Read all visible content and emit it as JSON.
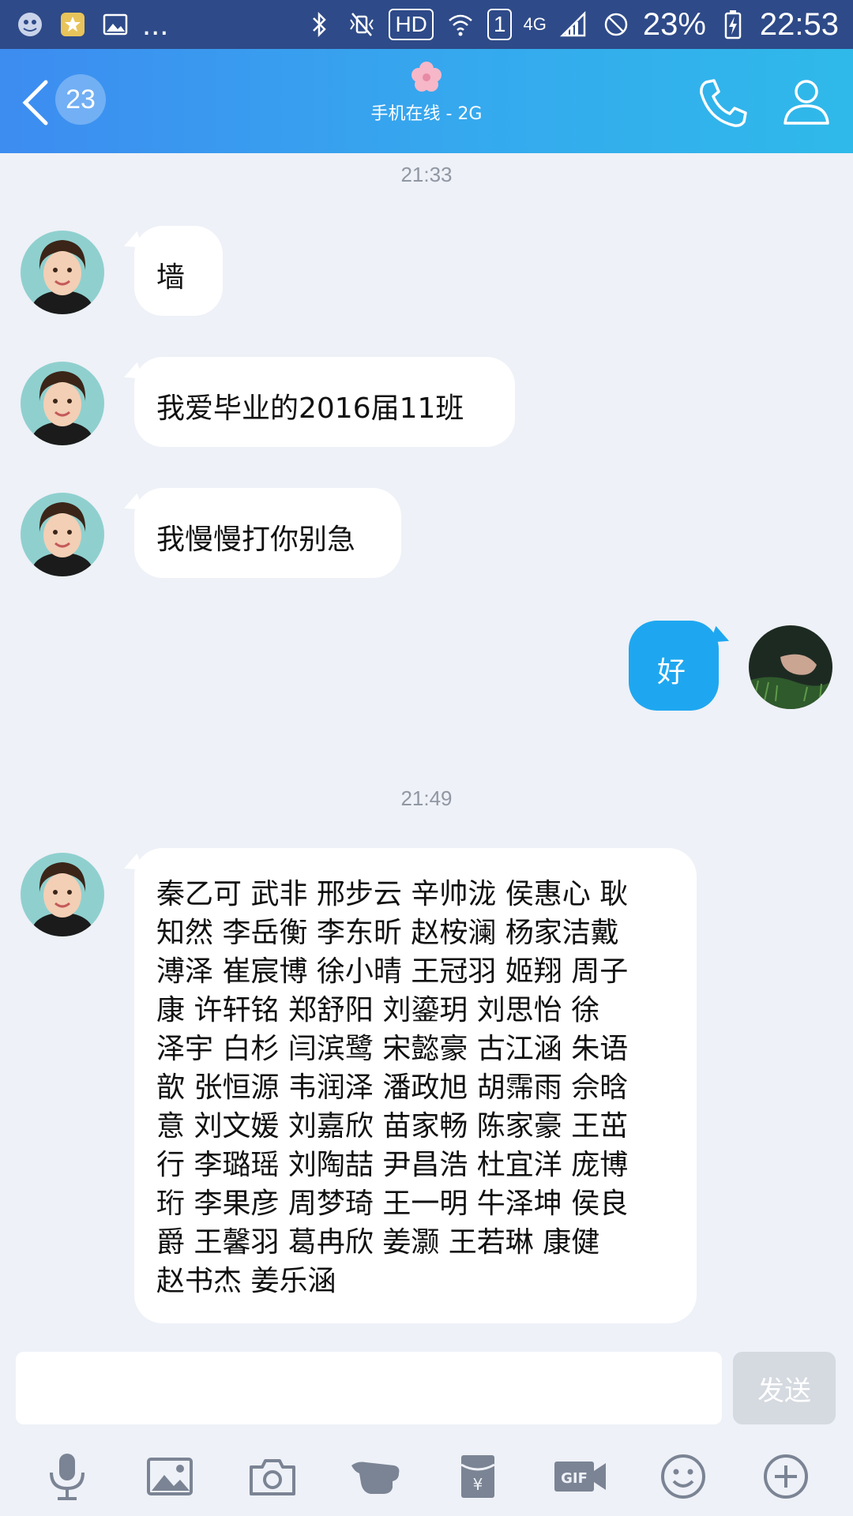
{
  "status_bar": {
    "more": "...",
    "hd": "HD",
    "sim": "1",
    "network": "4G",
    "battery": "23%",
    "time": "22:53"
  },
  "header": {
    "unread_count": "23",
    "status": "手机在线 - 2G"
  },
  "messages": [
    {
      "timestamp": "21:33"
    },
    {
      "side": "left",
      "text": "墙"
    },
    {
      "side": "left",
      "text": "我爱毕业的2016届11班"
    },
    {
      "side": "left",
      "text": "我慢慢打你别急"
    },
    {
      "side": "right",
      "text": "好"
    },
    {
      "timestamp": "21:49"
    },
    {
      "side": "left",
      "lines": [
        "秦乙可 武非 邢步云 辛帅泷 侯惠心 耿",
        "知然 李岳衡 李东昕 赵桉澜 杨家洁戴",
        "溥泽 崔宸博 徐小晴 王冠羽 姬翔 周子",
        "康 许轩铭 郑舒阳 刘鎏玥 刘思怡 徐",
        "泽宇 白杉 闫滨鹭 宋懿豪 古江涵 朱语",
        "歆 张恒源 韦润泽 潘政旭 胡霈雨 佘晗",
        "意 刘文媛 刘嘉欣 苗家畅 陈家豪 王茁",
        "行 李璐瑶 刘陶喆 尹昌浩 杜宜洋 庞博",
        "珩 李果彦 周梦琦 王一明 牛泽坤 侯良",
        "爵 王馨羽 葛冉欣 姜灏 王若琳 康健",
        "赵书杰 姜乐涵"
      ]
    }
  ],
  "input": {
    "value": "",
    "send_label": "发送"
  },
  "colors": {
    "status_bar": "#2e4a88",
    "header_start": "#3d8cf0",
    "header_end": "#2fb9ea",
    "my_bubble": "#1ea7f0",
    "background": "#eef1f7"
  },
  "toolbar_icons": [
    "microphone-icon",
    "image-icon",
    "camera-icon",
    "hand-icon",
    "red-packet-icon",
    "gif-icon",
    "emoji-icon",
    "plus-icon"
  ]
}
